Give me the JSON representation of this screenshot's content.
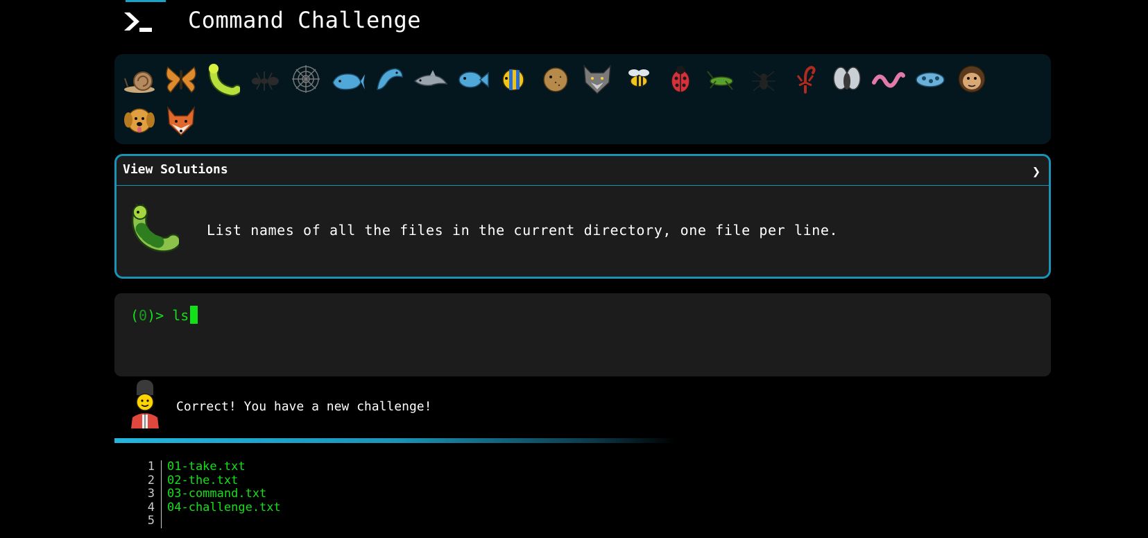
{
  "header": {
    "title": "Command Challenge",
    "logo_icon": "terminal-prompt-icon"
  },
  "animals": [
    {
      "name": "snail-icon",
      "label": "snail"
    },
    {
      "name": "butterfly-icon",
      "label": "butterfly"
    },
    {
      "name": "caterpillar-icon",
      "label": "caterpillar"
    },
    {
      "name": "ant-icon",
      "label": "ant"
    },
    {
      "name": "spider-web-icon",
      "label": "spider web"
    },
    {
      "name": "whale-icon",
      "label": "whale"
    },
    {
      "name": "dolphin-jump-icon",
      "label": "dolphin"
    },
    {
      "name": "dolphin-icon",
      "label": "dolphin"
    },
    {
      "name": "fish-icon",
      "label": "fish"
    },
    {
      "name": "tropical-fish-icon",
      "label": "tropical fish"
    },
    {
      "name": "blowfish-icon",
      "label": "blowfish"
    },
    {
      "name": "wolf-icon",
      "label": "wolf"
    },
    {
      "name": "bee-icon",
      "label": "bee"
    },
    {
      "name": "ladybug-icon",
      "label": "ladybug"
    },
    {
      "name": "cricket-icon",
      "label": "cricket"
    },
    {
      "name": "spider-icon",
      "label": "spider"
    },
    {
      "name": "scorpion-icon",
      "label": "scorpion"
    },
    {
      "name": "fly-icon",
      "label": "fly"
    },
    {
      "name": "worm-icon",
      "label": "worm"
    },
    {
      "name": "microbe-icon",
      "label": "microbe"
    },
    {
      "name": "monkey-icon",
      "label": "monkey"
    },
    {
      "name": "dog-icon",
      "label": "dog"
    },
    {
      "name": "fox-icon",
      "label": "fox"
    }
  ],
  "challenge": {
    "view_solutions_label": "View Solutions",
    "chevron": "❯",
    "critter_icon": "caterpillar-icon",
    "description": "List names of all the files in the current directory, one file per line."
  },
  "terminal": {
    "prompt_open": "(",
    "prompt_num": "0",
    "prompt_close": ")> ",
    "input": "ls"
  },
  "feedback": {
    "icon": "guard-icon",
    "message": "Correct! You have a new challenge!"
  },
  "output": {
    "lines": [
      {
        "num": "1",
        "text": "01-take.txt"
      },
      {
        "num": "2",
        "text": "02-the.txt"
      },
      {
        "num": "3",
        "text": "03-command.txt"
      },
      {
        "num": "4",
        "text": "04-challenge.txt"
      },
      {
        "num": "5",
        "text": ""
      }
    ]
  },
  "colors": {
    "accent": "#1b93b7",
    "terminal_green": "#14e01a",
    "panel": "#1c1c1c",
    "animal_strip": "#04171f"
  }
}
